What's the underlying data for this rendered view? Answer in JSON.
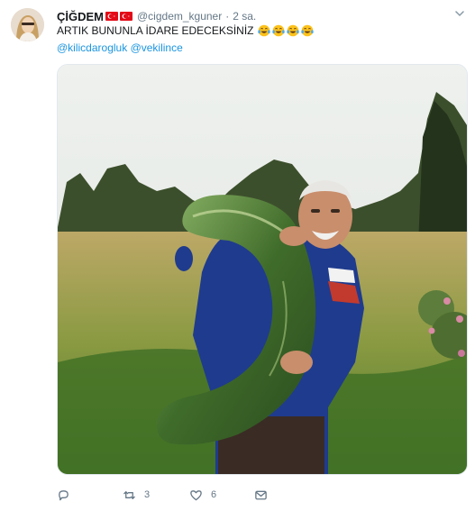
{
  "tweet": {
    "author_name": "ÇİĞDEM",
    "author_flags": [
      "tr-flag",
      "tr-flag"
    ],
    "handle": "@cigdem_kguner",
    "separator": "·",
    "timestamp": "2 sa.",
    "text": "ARTIK BUNUNLA İDARE EDECEKSİNİZ",
    "emojis": [
      "tears-of-joy-emoji",
      "tears-of-joy-emoji",
      "tears-of-joy-emoji",
      "tears-of-joy-emoji"
    ],
    "mentions": [
      "@kilicdarogluk",
      "@vekilince"
    ],
    "photo_icon": "photo"
  },
  "actions": {
    "reply_count": "",
    "retweet_count": "3",
    "like_count": "6",
    "dm_count": ""
  },
  "colors": {
    "link": "#1b95e0",
    "muted": "#657786",
    "flag_red": "#e30a17"
  }
}
